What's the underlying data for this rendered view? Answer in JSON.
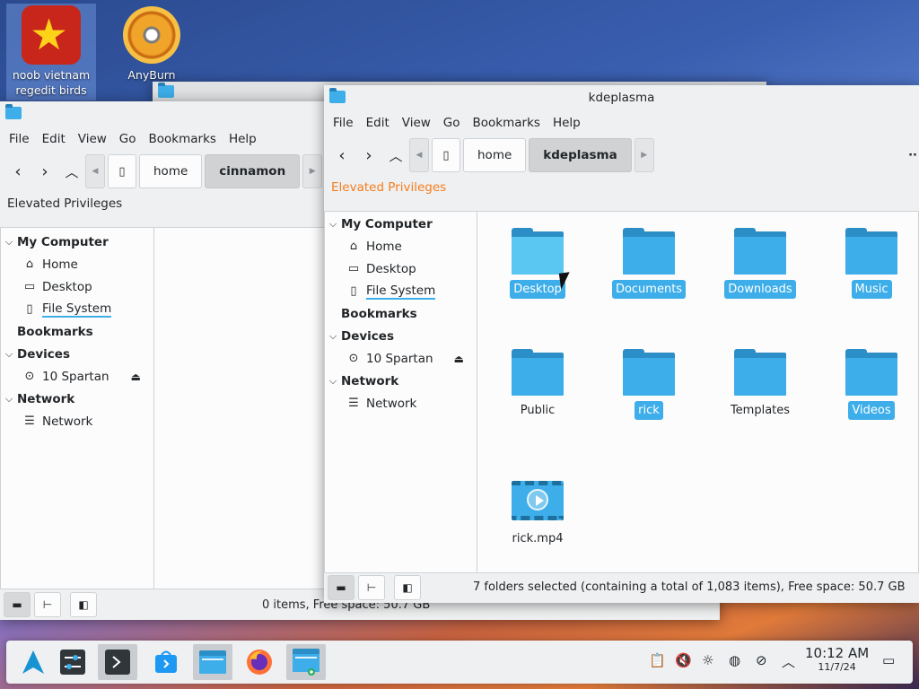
{
  "desktop": {
    "icons": [
      {
        "label_line1": "noob vietnam",
        "label_line2": "regedit birds",
        "icon": "noob-vietnam-app-icon"
      },
      {
        "label_line1": "AnyBurn",
        "label_line2": "",
        "icon": "anyburn-disc-icon"
      }
    ]
  },
  "window_cinnamon": {
    "menu": [
      "File",
      "Edit",
      "View",
      "Go",
      "Bookmarks",
      "Help"
    ],
    "breadcrumbs": [
      "home",
      "cinnamon"
    ],
    "elevated_label": "Elevated Privileges",
    "sidebar": {
      "my_computer": "My Computer",
      "home": "Home",
      "desktop": "Desktop",
      "file_system": "File System",
      "bookmarks": "Bookmarks",
      "devices": "Devices",
      "spartan": "10 Spartan",
      "network_header": "Network",
      "network_item": "Network"
    },
    "status": "0 items, Free space: 50.7 GB"
  },
  "window_kde": {
    "title": "kdeplasma",
    "menu": [
      "File",
      "Edit",
      "View",
      "Go",
      "Bookmarks",
      "Help"
    ],
    "breadcrumbs": [
      "home",
      "kdeplasma"
    ],
    "elevated_label": "Elevated Privileges",
    "elevated_color": "#f47d1e",
    "sidebar": {
      "my_computer": "My Computer",
      "home": "Home",
      "desktop": "Desktop",
      "file_system": "File System",
      "bookmarks": "Bookmarks",
      "devices": "Devices",
      "spartan": "10 Spartan",
      "network_header": "Network",
      "network_item": "Network"
    },
    "items": [
      {
        "name": "Desktop",
        "type": "folder",
        "selected": true
      },
      {
        "name": "Documents",
        "type": "folder",
        "selected": true
      },
      {
        "name": "Downloads",
        "type": "folder",
        "selected": true
      },
      {
        "name": "Music",
        "type": "folder",
        "selected": true
      },
      {
        "name": "Public",
        "type": "folder",
        "selected": false
      },
      {
        "name": "rick",
        "type": "folder",
        "selected": true
      },
      {
        "name": "Templates",
        "type": "folder",
        "selected": false
      },
      {
        "name": "Videos",
        "type": "folder",
        "selected": true
      },
      {
        "name": "rick.mp4",
        "type": "video",
        "selected": false
      }
    ],
    "status": "7 folders selected (containing a total of 1,083 items), Free space: 50.7 GB"
  },
  "taskbar": {
    "apps": [
      "app-launcher-icon",
      "system-settings-icon",
      "terminal-icon",
      "software-center-icon",
      "file-manager-icon",
      "firefox-icon",
      "file-manager-root-icon"
    ],
    "tray": [
      "clipboard-icon",
      "volume-muted-icon",
      "brightness-icon",
      "network-icon",
      "updates-icon",
      "tray-expand-icon"
    ],
    "time": "10:12 AM",
    "date": "11/7/24"
  },
  "colors": {
    "accent": "#3daee9",
    "window_bg": "#eff0f1",
    "view_bg": "#fcfcfc"
  }
}
